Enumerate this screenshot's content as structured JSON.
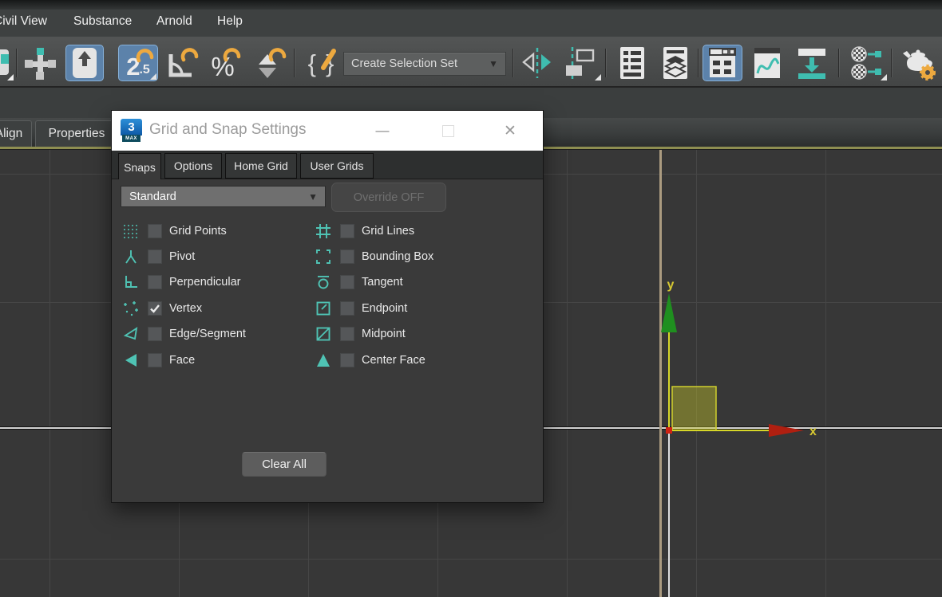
{
  "menu_bar": {
    "items": [
      {
        "label": "Civil View"
      },
      {
        "label": "Substance"
      },
      {
        "label": "Arnold"
      },
      {
        "label": "Help"
      }
    ]
  },
  "toolbar": {
    "create_selection_set": {
      "value": "Create Selection Set"
    },
    "glyphs": {
      "snap_main": "2",
      "snap_sub": ".5",
      "percent": "%",
      "brace_left": "{",
      "brace_right": "}",
      "caret_down": "▼"
    },
    "buttons": [
      {
        "name": "select-and-manipulate",
        "active": false
      },
      {
        "name": "select-and-place",
        "active": true
      },
      {
        "name": "snaps-toggle-2.5",
        "active": true
      },
      {
        "name": "angle-snap-toggle",
        "active": false
      },
      {
        "name": "percent-snap-toggle",
        "active": false
      },
      {
        "name": "spinner-snap-toggle",
        "active": false
      },
      {
        "name": "edit-named-selection-sets",
        "active": false
      },
      {
        "name": "mirror",
        "active": false
      },
      {
        "name": "align",
        "active": false
      },
      {
        "name": "toggle-scene-explorer",
        "active": false
      },
      {
        "name": "toggle-layer-explorer",
        "active": false
      },
      {
        "name": "toggle-ribbon",
        "active": true
      },
      {
        "name": "curve-editor",
        "active": false
      },
      {
        "name": "schematic-view",
        "active": false
      },
      {
        "name": "material-editor",
        "active": false
      },
      {
        "name": "render-setup",
        "active": false
      }
    ]
  },
  "panel_tabs": {
    "items": [
      {
        "label": "Align"
      },
      {
        "label": "Properties"
      }
    ]
  },
  "dialog": {
    "title": "Grid and Snap Settings",
    "logo": {
      "number": "3",
      "sub": "MAX"
    },
    "window_controls": {
      "minimize": "—",
      "close": "✕"
    },
    "tabs": [
      {
        "label": "Snaps",
        "active": true
      },
      {
        "label": "Options",
        "active": false
      },
      {
        "label": "Home Grid",
        "active": false
      },
      {
        "label": "User Grids",
        "active": false
      }
    ],
    "preset_dropdown": {
      "value": "Standard"
    },
    "override_button": {
      "label": "Override OFF",
      "disabled": true
    },
    "snap_items": [
      {
        "label": "Grid Points",
        "icon": "grid-points",
        "checked": false
      },
      {
        "label": "Grid Lines",
        "icon": "grid-lines",
        "checked": false
      },
      {
        "label": "Pivot",
        "icon": "pivot",
        "checked": false
      },
      {
        "label": "Bounding Box",
        "icon": "bounding-box",
        "checked": false
      },
      {
        "label": "Perpendicular",
        "icon": "perpendicular",
        "checked": false
      },
      {
        "label": "Tangent",
        "icon": "tangent",
        "checked": false
      },
      {
        "label": "Vertex",
        "icon": "vertex",
        "checked": true
      },
      {
        "label": "Endpoint",
        "icon": "endpoint",
        "checked": false
      },
      {
        "label": "Edge/Segment",
        "icon": "edge-segment",
        "checked": false
      },
      {
        "label": "Midpoint",
        "icon": "midpoint",
        "checked": false
      },
      {
        "label": "Face",
        "icon": "face",
        "checked": false
      },
      {
        "label": "Center Face",
        "icon": "center-face",
        "checked": false
      }
    ],
    "clear_all_button": {
      "label": "Clear All"
    }
  },
  "viewport": {
    "axis_labels": {
      "x": "x",
      "y": "y"
    },
    "colors": {
      "background": "#373737",
      "grid_line": "#464646",
      "active_border": "#8e8e51",
      "axis_x_arrow": "#b01f10",
      "axis_y_arrow": "#1f8f1f",
      "gizmo_yellow": "#d6d628",
      "accent_teal": "#4fc3b4",
      "accent_orange": "#eda93f",
      "highlight_blue": "#5c82aa"
    }
  }
}
